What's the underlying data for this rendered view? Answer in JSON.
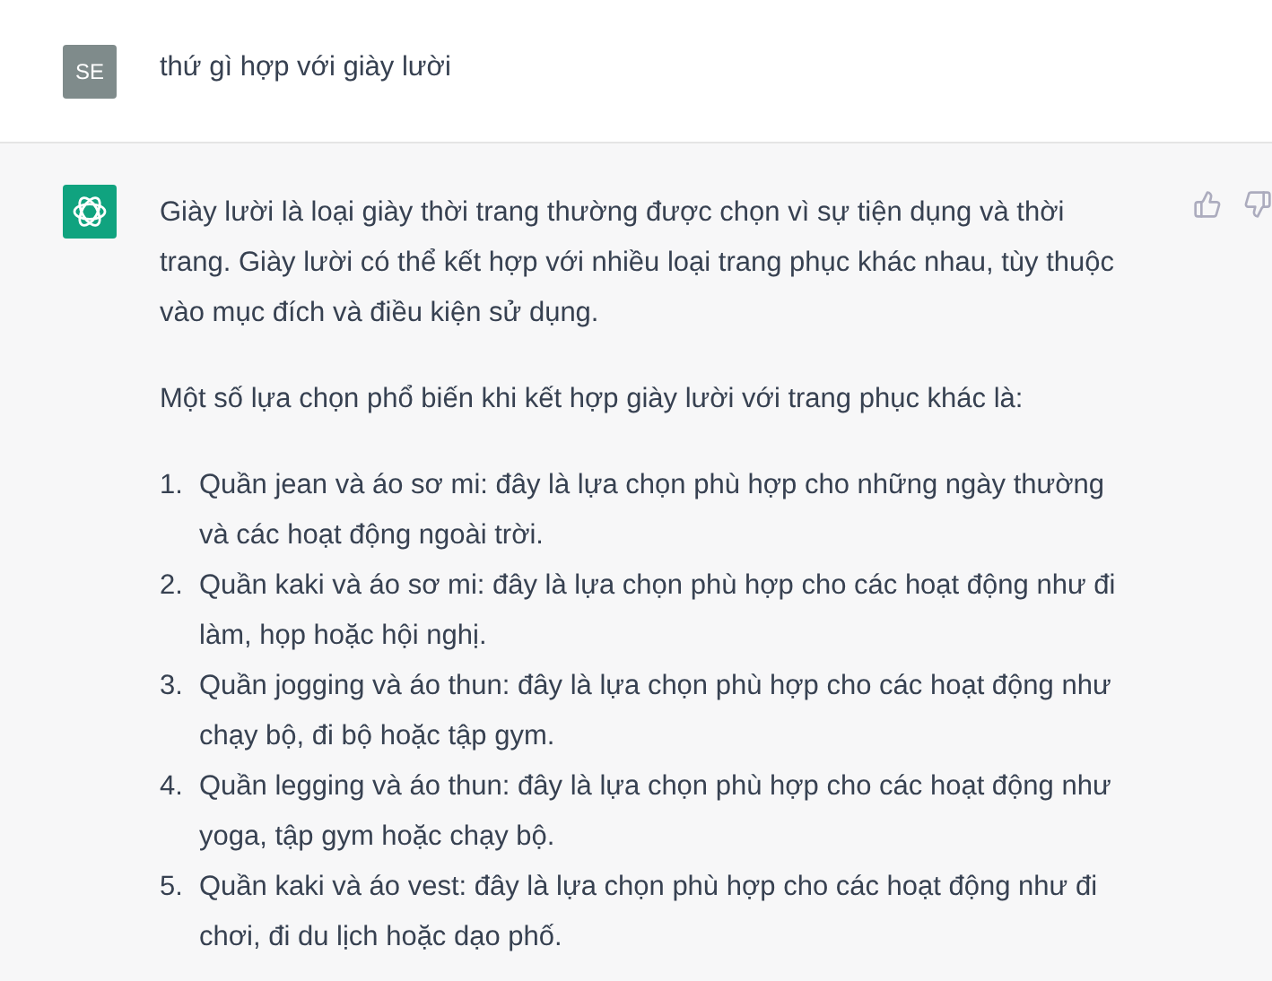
{
  "user_message": {
    "avatar": "SE",
    "text": "thứ gì hợp với giày lười"
  },
  "assistant_message": {
    "paragraphs": [
      "Giày lười là loại giày thời trang thường được chọn vì sự tiện dụng và thời trang. Giày lười có thể kết hợp với nhiều loại trang phục khác nhau, tùy thuộc vào mục đích và điều kiện sử dụng.",
      "Một số lựa chọn phổ biến khi kết hợp giày lười với trang phục khác là:"
    ],
    "list": [
      {
        "number": "1.",
        "text": "Quần jean và áo sơ mi: đây là lựa chọn phù hợp cho những ngày thường và các hoạt động ngoài trời."
      },
      {
        "number": "2.",
        "text": "Quần kaki và áo sơ mi: đây là lựa chọn phù hợp cho các hoạt động như đi làm, họp hoặc hội nghị."
      },
      {
        "number": "3.",
        "text": "Quần jogging và áo thun: đây là lựa chọn phù hợp cho các hoạt động như chạy bộ, đi bộ hoặc tập gym."
      },
      {
        "number": "4.",
        "text": "Quần legging và áo thun: đây là lựa chọn phù hợp cho các hoạt động như yoga, tập gym hoặc chạy bộ."
      },
      {
        "number": "5.",
        "text": "Quần kaki và áo vest: đây là lựa chọn phù hợp cho các hoạt động như đi chơi, đi du lịch hoặc dạo phố."
      }
    ]
  }
}
